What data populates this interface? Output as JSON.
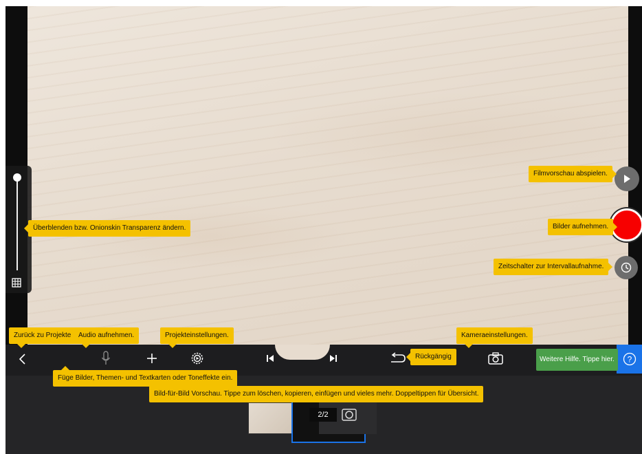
{
  "tooltips": {
    "onionskin": "Überblenden bzw. Onionskin Transparenz ändern.",
    "play": "Filmvorschau abspielen.",
    "record": "Bilder aufnehmen.",
    "timer": "Zeitschalter zur Intervallaufnahme.",
    "back": "Zurück zu Projekte",
    "audio": "Audio aufnehmen.",
    "project_settings": "Projekteinstellungen.",
    "camera_settings": "Kameraeinstellungen.",
    "undo": "Rückgängig",
    "add": "Füge Bilder, Themen- und Textkarten oder Toneffekte ein.",
    "preview": "Bild-für-Bild Vorschau. Tippe zum löschen, kopieren, einfügen und vieles mehr. Doppeltippen für Übersicht.",
    "more_help": "Weitere Hilfe. Tippe hier."
  },
  "timeline": {
    "frame_counter": "2/2"
  },
  "slider": {
    "opacity_level": 1.0
  },
  "icons": [
    "grid-icon",
    "play-icon",
    "record-icon",
    "clock-icon",
    "chevron-left-icon",
    "microphone-icon",
    "plus-icon",
    "settings-gear-icon",
    "skip-back-icon",
    "skip-forward-icon",
    "undo-icon",
    "camera-icon",
    "help-icon"
  ],
  "colors": {
    "tooltip": "#f4c100",
    "help_tooltip": "#4a9f4a",
    "record": "#f70000",
    "accent": "#1a73e8"
  }
}
